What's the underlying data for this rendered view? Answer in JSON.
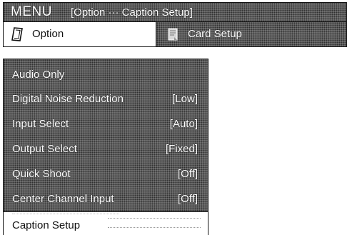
{
  "header": {
    "title": "MENU",
    "path": "[Option ··· Caption Setup]"
  },
  "tabs": [
    {
      "label": "Option",
      "icon": "option-pencil-icon",
      "active": true
    },
    {
      "label": "Card Setup",
      "icon": "card-icon",
      "active": false
    }
  ],
  "menu": {
    "items": [
      {
        "label": "Audio Only",
        "value": ""
      },
      {
        "label": "Digital Noise Reduction",
        "value": "[Low]"
      },
      {
        "label": "Input Select",
        "value": "[Auto]"
      },
      {
        "label": "Output Select",
        "value": "[Fixed]"
      },
      {
        "label": "Quick Shoot",
        "value": "[Off]"
      },
      {
        "label": "Center Channel Input",
        "value": "[Off]"
      },
      {
        "label": "Caption Setup",
        "value": "",
        "selected": true
      }
    ]
  },
  "colors": {
    "panel_tone": "#6a6a6a",
    "selected_bg": "#ffffff",
    "text_light": "#ffffff",
    "text_dark": "#111111"
  }
}
